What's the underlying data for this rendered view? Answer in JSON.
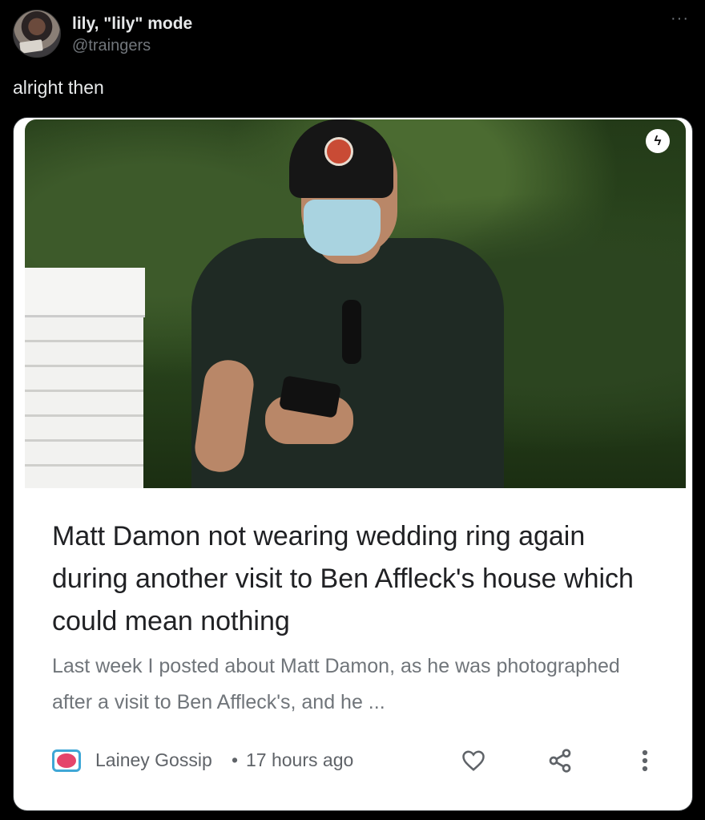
{
  "tweet": {
    "display_name": "lily, \"lily\" mode",
    "handle": "@traingers",
    "more_icon": "more-horizontal-icon",
    "text": "alright then"
  },
  "card": {
    "image_badge_icon": "lightning-bolt-icon",
    "headline": "Matt Damon not wearing wedding ring again during another visit to Ben Affleck's house which could mean nothing",
    "snippet": "Last week I posted about Matt Damon, as he was photographed after a visit to Ben Affleck's, and he ...",
    "source": {
      "name": "Lainey Gossip",
      "separator": "•",
      "time": "17 hours ago"
    },
    "actions": [
      "heart-icon",
      "share-icon",
      "more-vertical-icon"
    ]
  }
}
